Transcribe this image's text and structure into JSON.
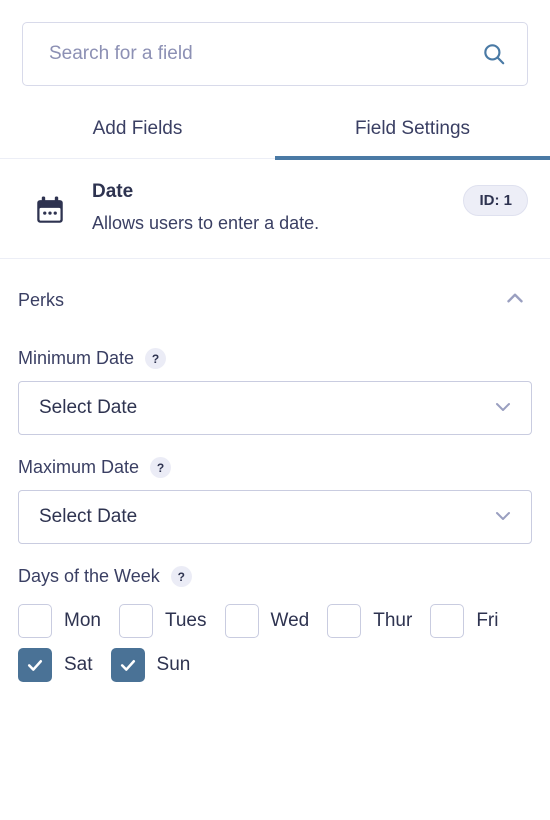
{
  "search": {
    "placeholder": "Search for a field",
    "value": "",
    "icon": "search-icon"
  },
  "tabs": [
    {
      "label": "Add Fields",
      "active": false
    },
    {
      "label": "Field Settings",
      "active": true
    }
  ],
  "field": {
    "icon": "calendar-icon",
    "title": "Date",
    "description": "Allows users to enter a date.",
    "id_badge": "ID: 1"
  },
  "section": {
    "title": "Perks",
    "collapse_icon": "chevron-up-icon",
    "expanded": true
  },
  "settings": {
    "minimum_date": {
      "label": "Minimum Date",
      "help": "?",
      "value": "Select Date",
      "chevron": "chevron-down-icon"
    },
    "maximum_date": {
      "label": "Maximum Date",
      "help": "?",
      "value": "Select Date",
      "chevron": "chevron-down-icon"
    },
    "days_of_week": {
      "label": "Days of the Week",
      "help": "?",
      "days": [
        {
          "label": "Mon",
          "checked": false
        },
        {
          "label": "Tues",
          "checked": false
        },
        {
          "label": "Wed",
          "checked": false
        },
        {
          "label": "Thur",
          "checked": false
        },
        {
          "label": "Fri",
          "checked": false
        },
        {
          "label": "Sat",
          "checked": true
        },
        {
          "label": "Sun",
          "checked": true
        }
      ]
    }
  },
  "colors": {
    "accent": "#4a7aa5",
    "checkbox_checked": "#4a7296",
    "text": "#2e3350",
    "muted": "#8c90b4",
    "border": "#c9cce0",
    "badge_bg": "#edeef7"
  }
}
